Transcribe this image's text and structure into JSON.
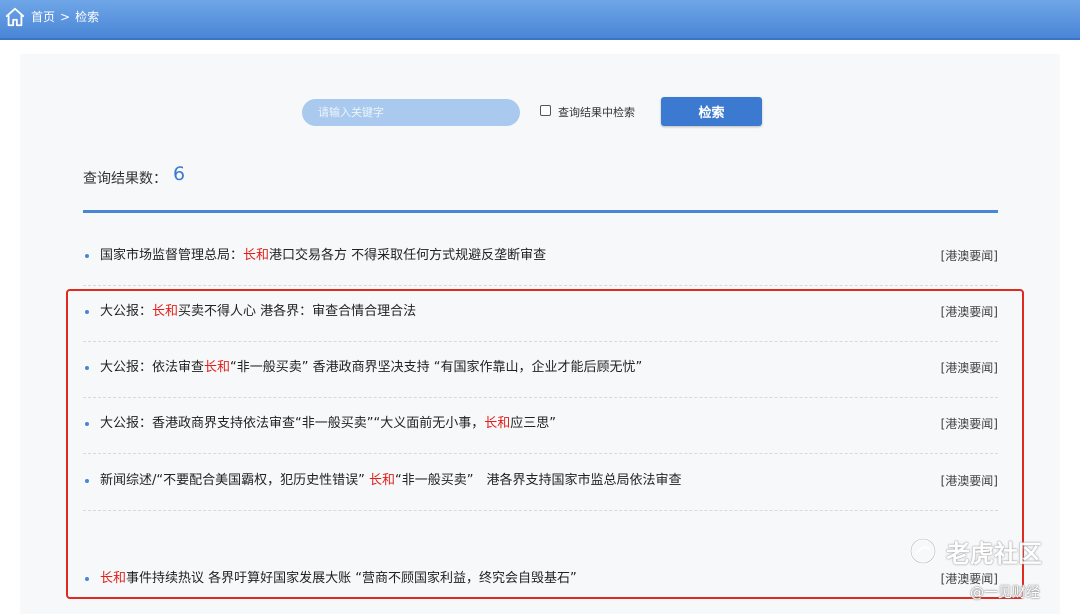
{
  "breadcrumb": {
    "home": "首页",
    "separator": ">",
    "current": "检索"
  },
  "search": {
    "placeholder": "请输入关键字",
    "value": "",
    "scope_label": "查询结果中检索",
    "scope_checked": false,
    "button_label": "检索"
  },
  "results_count": {
    "label": "查询结果数：",
    "value": "6"
  },
  "results": [
    {
      "parts": [
        {
          "text": "国家市场监督管理总局："
        },
        {
          "text": "长和",
          "highlight": true
        },
        {
          "text": "港口交易各方 不得采取任何方式规避反垄断审查"
        }
      ],
      "category": "[港澳要闻]"
    },
    {
      "parts": [
        {
          "text": "大公报："
        },
        {
          "text": "长和",
          "highlight": true
        },
        {
          "text": "买卖不得人心 港各界：审查合情合理合法"
        }
      ],
      "category": "[港澳要闻]"
    },
    {
      "parts": [
        {
          "text": "大公报：依法审查"
        },
        {
          "text": "长和",
          "highlight": true
        },
        {
          "text": "“非一般买卖” 香港政商界坚决支持 “有国家作靠山，企业才能后顾无忧”"
        }
      ],
      "category": "[港澳要闻]"
    },
    {
      "parts": [
        {
          "text": "大公报：香港政商界支持依法审查“非一般买卖”“大义面前无小事，"
        },
        {
          "text": "长和",
          "highlight": true
        },
        {
          "text": "应三思”"
        }
      ],
      "category": "[港澳要闻]"
    },
    {
      "parts": [
        {
          "text": "新闻综述/“不要配合美国霸权，犯历史性错误” "
        },
        {
          "text": "长和",
          "highlight": true
        },
        {
          "text": "“非一般买卖”　港各界支持国家市监总局依法审查"
        }
      ],
      "category": "[港澳要闻]"
    },
    {
      "parts": [
        {
          "text": "长和",
          "highlight": true
        },
        {
          "text": "事件持续热议 各界吁算好国家发展大账 “营商不顾国家利益，终究会自毁基石”"
        }
      ],
      "category": "[港澳要闻]"
    }
  ],
  "colors": {
    "accent": "#3b7ad0",
    "highlight": "#e0201a",
    "annotation_box": "#e02a1f"
  },
  "watermark": {
    "brand": "老虎社区",
    "source": "@一见财经"
  }
}
